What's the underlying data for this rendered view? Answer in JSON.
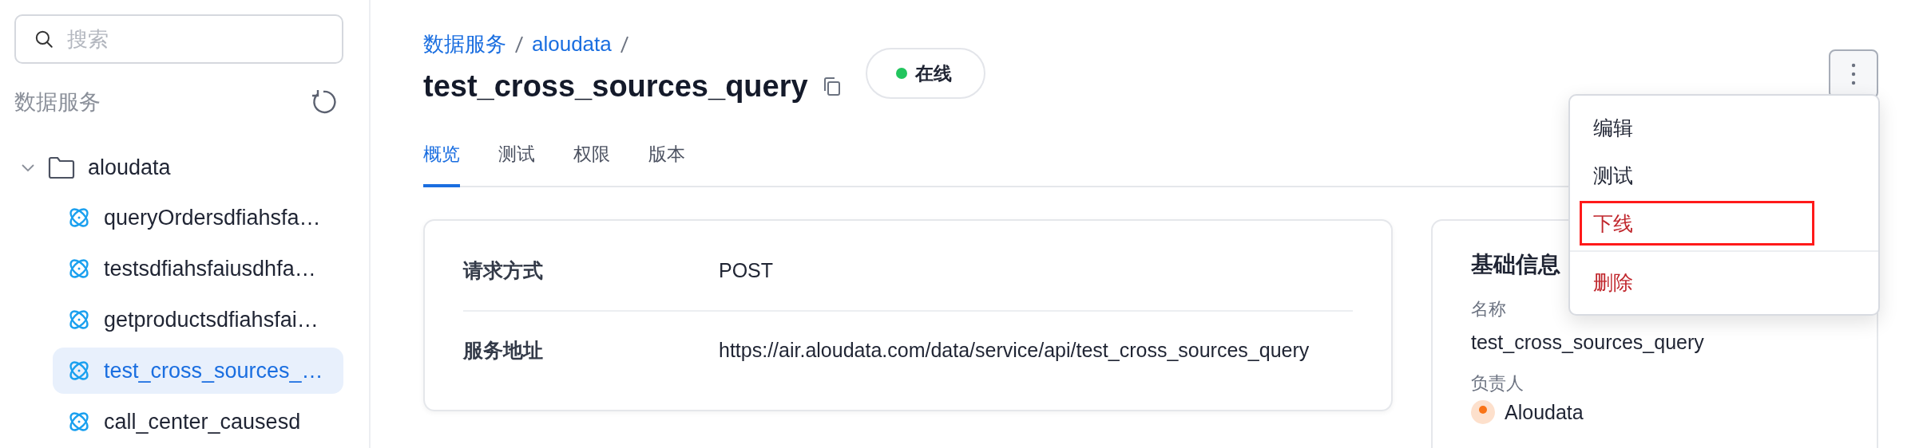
{
  "sidebar": {
    "search": {
      "placeholder": "搜索"
    },
    "section_title": "数据服务",
    "tree": [
      {
        "label": "aloudata",
        "expanded": true,
        "children": [
          {
            "label": "queryOrdersdfiahsfa…",
            "selected": false
          },
          {
            "label": "testsdfiahsfaiusdhfa…",
            "selected": false
          },
          {
            "label": "getproductsdfiahsfai…",
            "selected": false
          },
          {
            "label": "test_cross_sources_…",
            "selected": true
          },
          {
            "label": "call_center_causesd",
            "selected": false
          }
        ]
      }
    ]
  },
  "breadcrumb": [
    "数据服务",
    "aloudata"
  ],
  "title": "test_cross_sources_query",
  "status": {
    "label": "在线",
    "color": "#22c55e"
  },
  "tabs": [
    {
      "label": "概览",
      "selected": true
    },
    {
      "label": "测试",
      "selected": false
    },
    {
      "label": "权限",
      "selected": false
    },
    {
      "label": "版本",
      "selected": false
    }
  ],
  "details": [
    {
      "label": "请求方式",
      "value": "POST"
    },
    {
      "label": "服务地址",
      "value": "https://air.aloudata.com/data/service/api/test_cross_sources_query"
    }
  ],
  "basic_info": {
    "title": "基础信息",
    "fields": [
      {
        "label": "名称",
        "value": "test_cross_sources_query"
      }
    ],
    "owner": {
      "label": "负责人",
      "name": "Aloudata"
    }
  },
  "menu": [
    {
      "label": "编辑",
      "kind": "normal",
      "highlighted": false,
      "divider_before": false
    },
    {
      "label": "测试",
      "kind": "normal",
      "highlighted": false,
      "divider_before": false
    },
    {
      "label": "下线",
      "kind": "danger",
      "highlighted": true,
      "divider_before": false
    },
    {
      "label": "删除",
      "kind": "danger",
      "highlighted": false,
      "divider_before": true
    }
  ]
}
